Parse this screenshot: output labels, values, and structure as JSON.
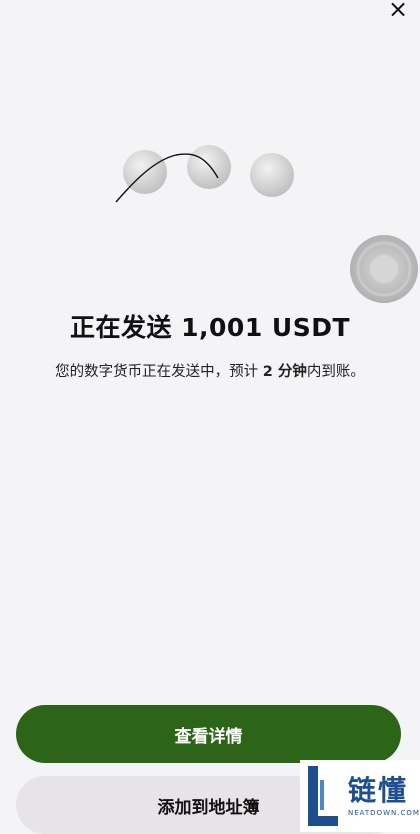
{
  "header": {
    "close_label": "×"
  },
  "status": {
    "title": "正在发送 1,001 USDT",
    "subtitle_before": "您的数字货币正在发送中，预计 ",
    "subtitle_time": "2 分钟",
    "subtitle_after": "内到账。"
  },
  "actions": {
    "primary_label": "查看详情",
    "secondary_label": "添加到地址簿"
  },
  "watermark": {
    "brand_cn": "链懂",
    "brand_en": "NEATDOWN.COM"
  },
  "colors": {
    "background": "#f4f3f5",
    "primary_button": "#2c6418",
    "secondary_button": "#e6e4e8",
    "watermark_blue": "#1d4f8f"
  },
  "icons": [
    "close-icon"
  ]
}
